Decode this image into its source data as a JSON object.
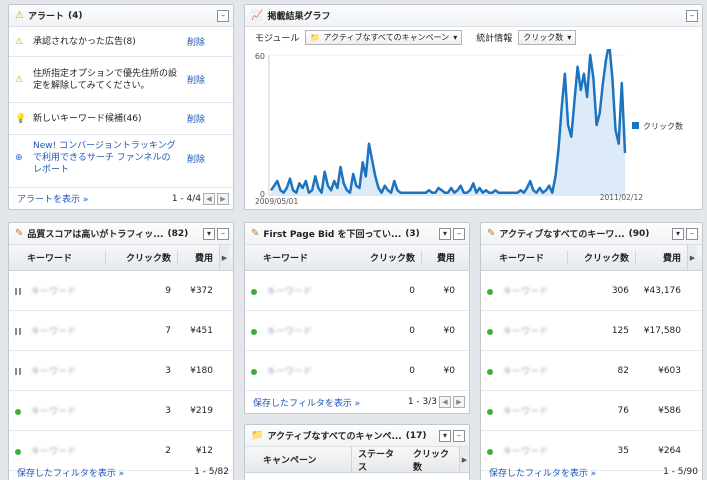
{
  "alerts": {
    "title": "アラート",
    "count": "(4)",
    "items": [
      {
        "icon": "warning-icon",
        "text": "承認されなかった広告(8)",
        "action": "削除"
      },
      {
        "icon": "warning-icon",
        "text": "住所指定オプションで優先住所の設定を解除してみてください。",
        "action": "削除"
      },
      {
        "icon": "lightbulb-icon",
        "text": "新しいキーワード候補(46)",
        "action": "削除"
      },
      {
        "icon": "plus-circle-icon",
        "text": "New! コンバージョントラッキングで利用できるサーチ ファンネルのレポート",
        "action": "削除"
      }
    ],
    "footer_link": "アラートを表示 »",
    "pager": "1 - 4/4"
  },
  "graph": {
    "title": "掲載結果グラフ",
    "module_label": "モジュール",
    "module_value": "アクティブなすべてのキャンペーン",
    "stat_label": "統計情報",
    "stat_value": "クリック数",
    "legend": "クリック数",
    "color": "#1e73be"
  },
  "chart_data": {
    "type": "area",
    "x_start": "2009/05/01",
    "x_end": "2011/02/12",
    "ylim": [
      0,
      60
    ],
    "yticks": [
      "60",
      "0"
    ],
    "series": [
      {
        "name": "クリック数",
        "values": [
          2,
          4,
          6,
          2,
          1,
          3,
          7,
          2,
          1,
          5,
          3,
          6,
          1,
          2,
          8,
          3,
          1,
          10,
          4,
          2,
          6,
          3,
          12,
          5,
          2,
          1,
          9,
          4,
          3,
          14,
          8,
          22,
          15,
          8,
          3,
          1,
          4,
          2,
          1,
          6,
          2,
          1,
          1,
          1,
          1,
          1,
          1,
          1,
          1,
          1,
          2,
          1,
          1,
          3,
          2,
          1,
          1,
          3,
          1,
          2,
          4,
          1,
          1,
          2,
          5,
          1,
          3,
          1,
          2,
          1,
          1,
          2,
          1,
          1,
          1,
          1,
          1,
          1,
          1,
          2,
          1,
          3,
          6,
          2,
          1,
          3,
          1,
          2,
          4,
          1,
          8,
          20,
          38,
          52,
          30,
          25,
          40,
          55,
          45,
          52,
          42,
          60,
          50,
          30,
          35,
          48,
          58,
          65,
          50,
          28,
          22,
          48,
          18
        ]
      }
    ]
  },
  "quality_table": {
    "title": "品質スコアは高いがトラフィッ...",
    "count": "(82)",
    "columns": [
      "キーワード",
      "クリック数",
      "費用"
    ],
    "rows": [
      {
        "status": "paused",
        "keyword": "キーワード",
        "clicks": "9",
        "cost": "¥372"
      },
      {
        "status": "paused",
        "keyword": "キーワード",
        "clicks": "7",
        "cost": "¥451"
      },
      {
        "status": "paused",
        "keyword": "キーワード",
        "clicks": "3",
        "cost": "¥180"
      },
      {
        "status": "active",
        "keyword": "キーワード",
        "clicks": "3",
        "cost": "¥219"
      },
      {
        "status": "active",
        "keyword": "キーワード",
        "clicks": "2",
        "cost": "¥12"
      }
    ],
    "footer_link": "保存したフィルタを表示 »",
    "pager": "1 - 5/82"
  },
  "firstpage_table": {
    "title": "First Page Bid を下回ってい...",
    "count": "(3)",
    "columns": [
      "キーワード",
      "クリック数",
      "費用"
    ],
    "rows": [
      {
        "status": "active",
        "keyword": "キーワード",
        "clicks": "0",
        "cost": "¥0"
      },
      {
        "status": "active",
        "keyword": "キーワード",
        "clicks": "0",
        "cost": "¥0"
      },
      {
        "status": "active",
        "keyword": "キーワード",
        "clicks": "0",
        "cost": "¥0"
      }
    ],
    "footer_link": "保存したフィルタを表示 »",
    "pager": "1 - 3/3"
  },
  "campaign_table": {
    "title": "アクティブなすべてのキャンペ...",
    "count": "(17)",
    "columns": [
      "キャンペーン",
      "ステータス",
      "クリック数"
    ]
  },
  "active_kw_table": {
    "title": "アクティブなすべてのキーワ...",
    "count": "(90)",
    "columns": [
      "キーワード",
      "クリック数",
      "費用"
    ],
    "rows": [
      {
        "status": "active",
        "keyword": "キーワード",
        "clicks": "306",
        "cost": "¥43,176"
      },
      {
        "status": "active",
        "keyword": "キーワード",
        "clicks": "125",
        "cost": "¥17,580"
      },
      {
        "status": "active",
        "keyword": "キーワード",
        "clicks": "82",
        "cost": "¥603"
      },
      {
        "status": "active",
        "keyword": "キーワード",
        "clicks": "76",
        "cost": "¥586"
      },
      {
        "status": "active",
        "keyword": "キーワード",
        "clicks": "35",
        "cost": "¥264"
      }
    ],
    "footer_link": "保存したフィルタを表示 »",
    "pager": "1 - 5/90"
  }
}
